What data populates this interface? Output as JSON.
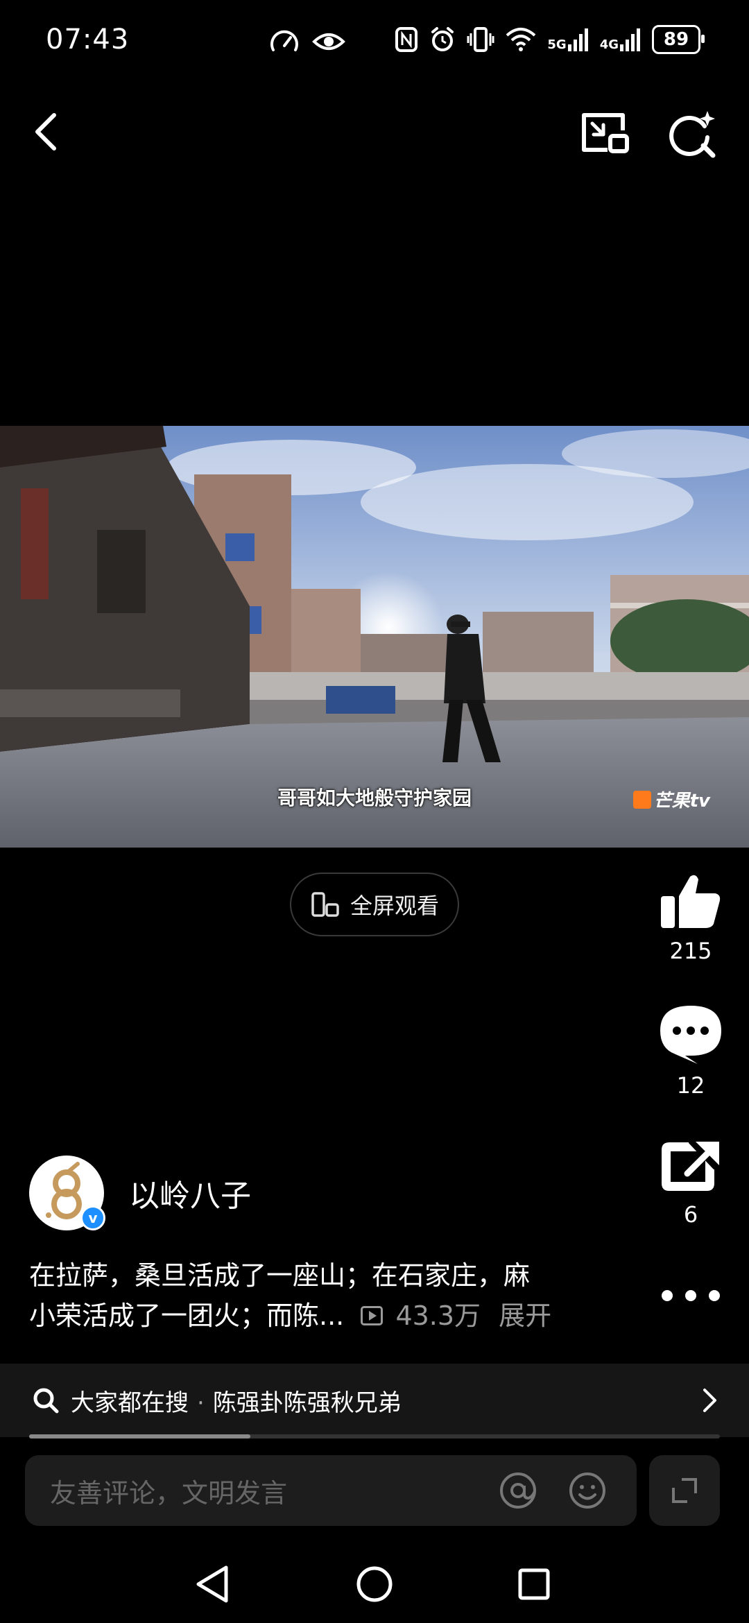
{
  "status_bar": {
    "time": "07:43",
    "network_5g": "5G",
    "network_4g": "4G",
    "battery": "89"
  },
  "video": {
    "subtitle": "哥哥如大地般守护家园",
    "watermark": "芒果tv"
  },
  "fullscreen": {
    "label": "全屏观看"
  },
  "actions": {
    "likes": "215",
    "comments": "12",
    "shares": "6"
  },
  "author": {
    "name": "以岭八子"
  },
  "description": {
    "line1": "在拉萨，桑旦活成了一座山；在石家庄，麻",
    "line2": "小荣活成了一团火；而陈...",
    "views": "43.3万",
    "expand": "展开"
  },
  "search_suggestion": {
    "prefix": "大家都在搜",
    "dot": "·",
    "query": "陈强卦陈强秋兄弟"
  },
  "progress": {
    "fraction": 0.32
  },
  "comment_bar": {
    "placeholder": "友善评论，文明发言"
  },
  "colors": {
    "background": "#000000",
    "watermark_accent": "#ff7a1a",
    "verified_badge": "#1d8fff"
  }
}
